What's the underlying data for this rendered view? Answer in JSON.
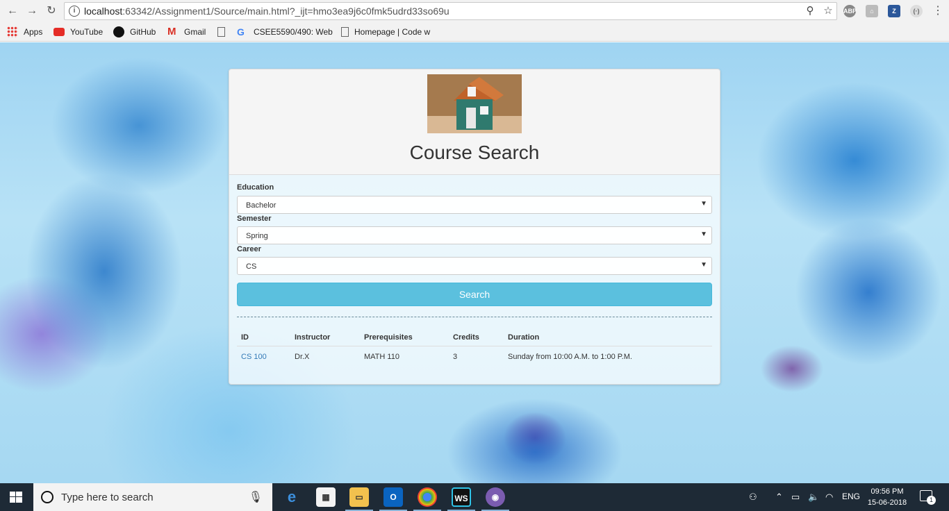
{
  "browser": {
    "url_host": "localhost",
    "url_rest": ":63342/Assignment1/Source/main.html?_ijt=hmo3ea9j6c0fmk5udrd33so69u",
    "info_label": "i",
    "ext_abp": "ABP",
    "ext_z": "Z"
  },
  "bookmarks": [
    {
      "label": "Apps"
    },
    {
      "label": "YouTube"
    },
    {
      "label": "GitHub"
    },
    {
      "label": "Gmail"
    },
    {
      "label": ""
    },
    {
      "label": "CSEE5590/490: Web"
    },
    {
      "label": "Homepage | Code w"
    }
  ],
  "card": {
    "title": "Course Search",
    "fields": [
      {
        "label": "Education",
        "value": "Bachelor"
      },
      {
        "label": "Semester",
        "value": "Spring"
      },
      {
        "label": "Career",
        "value": "CS"
      }
    ],
    "search_label": "Search"
  },
  "table": {
    "headers": [
      "ID",
      "Instructor",
      "Prerequisites",
      "Credits",
      "Duration"
    ],
    "rows": [
      [
        "CS 100",
        "Dr.X",
        "MATH 110",
        "3",
        "Sunday from 10:00 A.M. to 1:00 P.M."
      ]
    ]
  },
  "taskbar": {
    "search_placeholder": "Type here to search",
    "lang": "ENG",
    "time": "09:56 PM",
    "date": "15-06-2018",
    "notification_count": "1"
  }
}
